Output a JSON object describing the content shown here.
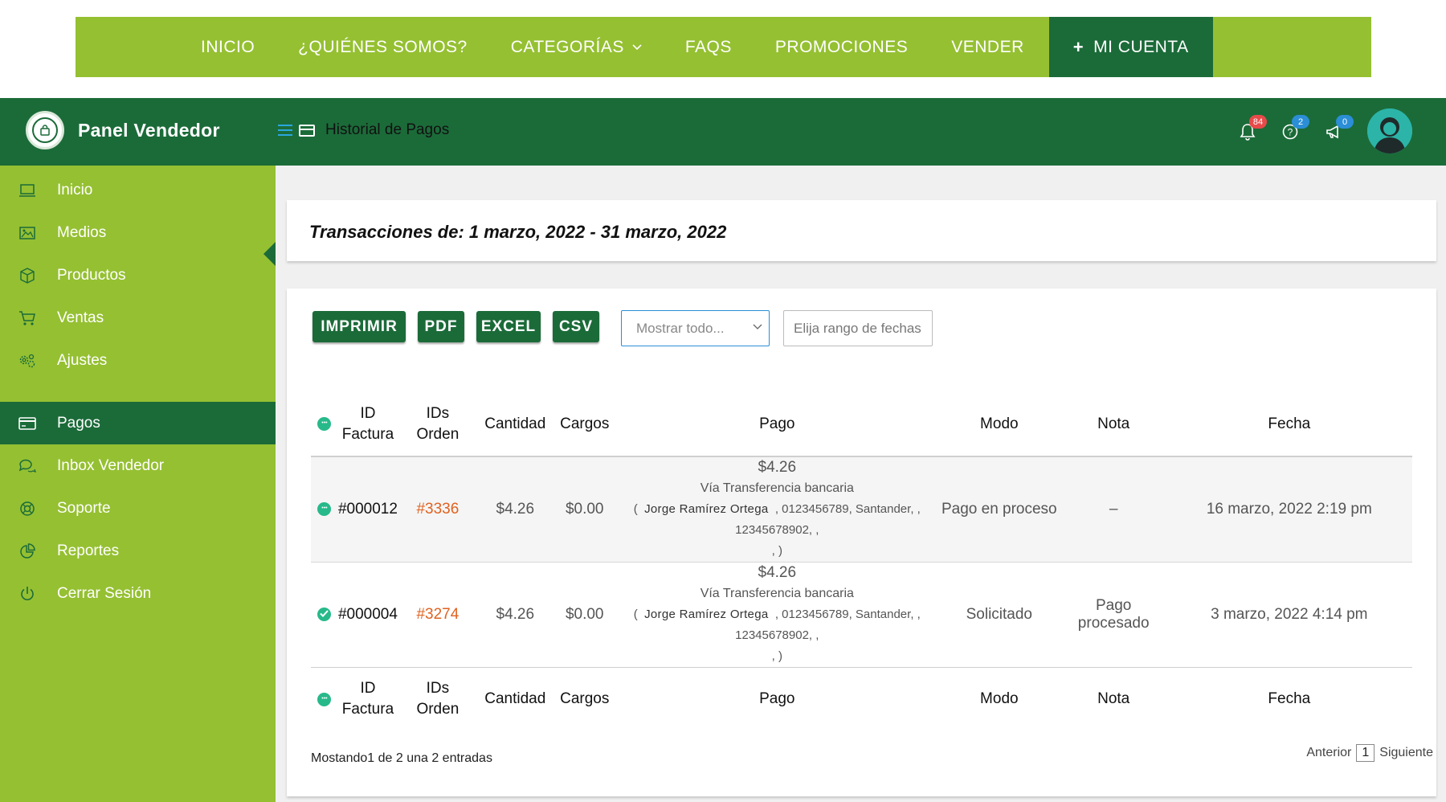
{
  "site_nav": {
    "items": [
      {
        "label": "INICIO"
      },
      {
        "label": "¿QUIÉNES SOMOS?"
      },
      {
        "label": "CATEGORÍAS",
        "has_dropdown": true
      },
      {
        "label": "FAQS"
      },
      {
        "label": "PROMOCIONES"
      },
      {
        "label": "VENDER"
      }
    ],
    "account_label": "MI CUENTA",
    "account_icon": "plus-icon"
  },
  "header": {
    "brand_title": "Panel Vendedor",
    "brand_icon": "shopping-bag-icon",
    "page_title": "Historial de Pagos",
    "notifications": {
      "icon": "bell-icon",
      "count": "84"
    },
    "help": {
      "icon": "question-circle-icon",
      "count": "2"
    },
    "announcements": {
      "icon": "megaphone-icon",
      "count": "0"
    },
    "avatar_icon": "user-avatar"
  },
  "sidebar": {
    "items": [
      {
        "label": "Inicio",
        "icon": "laptop-icon"
      },
      {
        "label": "Medios",
        "icon": "image-icon"
      },
      {
        "label": "Productos",
        "icon": "box-icon"
      },
      {
        "label": "Ventas",
        "icon": "cart-icon"
      },
      {
        "label": "Ajustes",
        "icon": "gears-icon"
      },
      {
        "label": "Pagos",
        "icon": "credit-card-icon",
        "active": true
      },
      {
        "label": "Inbox Vendedor",
        "icon": "chat-icon"
      },
      {
        "label": "Soporte",
        "icon": "lifebuoy-icon"
      },
      {
        "label": "Reportes",
        "icon": "pie-chart-icon"
      },
      {
        "label": "Cerrar Sesión",
        "icon": "power-icon"
      }
    ]
  },
  "summary": {
    "title": "Transacciones de: 1 marzo, 2022 - 31 marzo, 2022"
  },
  "toolbar": {
    "print_label": "IMPRIMIR",
    "pdf_label": "PDF",
    "excel_label": "EXCEL",
    "csv_label": "CSV",
    "filter_value": "Mostrar todo...",
    "date_placeholder": "Elija rango de fechas..."
  },
  "table": {
    "columns": {
      "invoice": [
        "ID",
        "Factura"
      ],
      "orders": [
        "IDs",
        "Orden"
      ],
      "amount": "Cantidad",
      "charges": "Cargos",
      "payment": "Pago",
      "mode": "Modo",
      "note": "Nota",
      "date": "Fecha"
    },
    "rows": [
      {
        "status": "pending",
        "invoice": "#000012",
        "order": "#3336",
        "amount": "$4.26",
        "charges": "$0.00",
        "pay_amount": "$4.26",
        "pay_via": "Vía Transferencia bancaria",
        "pay_open": "(",
        "pay_name": "Jorge Ramírez Ortega",
        "pay_rest": ", 0123456789, Santander, , 12345678902, ,",
        "pay_close": ", )",
        "mode": "Pago en proceso",
        "note": "–",
        "date": "16 marzo, 2022 2:19 pm"
      },
      {
        "status": "done",
        "invoice": "#000004",
        "order": "#3274",
        "amount": "$4.26",
        "charges": "$0.00",
        "pay_amount": "$4.26",
        "pay_via": "Vía Transferencia bancaria",
        "pay_open": "(",
        "pay_name": "Jorge Ramírez Ortega",
        "pay_rest": ", 0123456789, Santander, , 12345678902, ,",
        "pay_close": ", )",
        "mode": "Solicitado",
        "note": "Pago procesado",
        "date": "3 marzo, 2022 4:14 pm"
      }
    ]
  },
  "footer": {
    "info": "Mostando1 de 2 una 2 entradas",
    "prev_label": "Anterior",
    "page": "1",
    "next_label": "Siguiente"
  },
  "colors": {
    "brand_green": "#95c032",
    "dark_green": "#1b6b39",
    "status_teal": "#27b98a",
    "order_link": "#e0621f"
  }
}
